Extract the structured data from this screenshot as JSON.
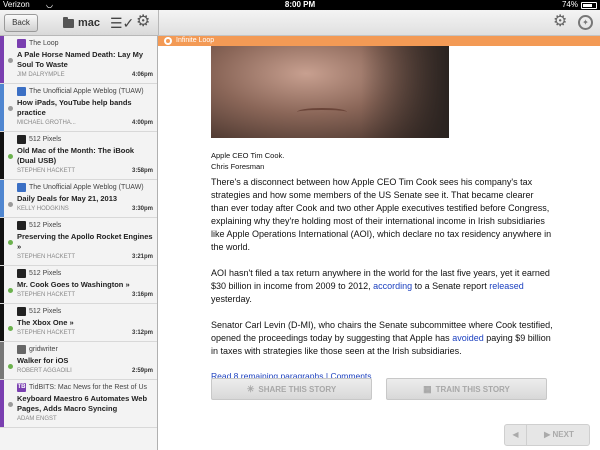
{
  "status_bar": {
    "carrier": "Verizon",
    "time": "8:00 PM",
    "battery": "74%",
    "battery_level": 0.74
  },
  "left_toolbar": {
    "back_label": "Back",
    "folder_label": "mac"
  },
  "stories": [
    {
      "feed": "The Loop",
      "feed_color": "#7a3fb0",
      "title": "A Pale Horse Named Death: Lay My Soul To Waste",
      "author": "JIM DALRYMPLE",
      "time": "4:06pm",
      "stripe_color": "#7a3fb0",
      "dot": "gray"
    },
    {
      "feed": "The Unofficial Apple Weblog (TUAW)",
      "feed_color": "#3b6fc4",
      "title": "How iPads, YouTube help bands practice",
      "author": "MICHAEL GROTHA...",
      "time": "4:00pm",
      "stripe_color": "#4f86d0",
      "dot": "gray"
    },
    {
      "feed": "512 Pixels",
      "feed_color": "#222222",
      "title": "Old Mac of the Month: The iBook (Dual USB)",
      "author": "STEPHEN HACKETT",
      "time": "3:58pm",
      "stripe_color": "#111111",
      "dot": "green"
    },
    {
      "feed": "The Unofficial Apple Weblog (TUAW)",
      "feed_color": "#3b6fc4",
      "title": "Daily Deals for May 21, 2013",
      "author": "KELLY HODGKINS",
      "time": "3:30pm",
      "stripe_color": "#4f86d0",
      "dot": "gray"
    },
    {
      "feed": "512 Pixels",
      "feed_color": "#222222",
      "title": "Preserving the Apollo Rocket Engines »",
      "author": "STEPHEN HACKETT",
      "time": "3:21pm",
      "stripe_color": "#111111",
      "dot": "green"
    },
    {
      "feed": "512 Pixels",
      "feed_color": "#222222",
      "title": "Mr. Cook Goes to Washington »",
      "author": "STEPHEN HACKETT",
      "time": "3:16pm",
      "stripe_color": "#111111",
      "dot": "green"
    },
    {
      "feed": "512 Pixels",
      "feed_color": "#222222",
      "title": "The Xbox One »",
      "author": "STEPHEN HACKETT",
      "time": "3:12pm",
      "stripe_color": "#111111",
      "dot": "green"
    },
    {
      "feed": "gridwriter",
      "feed_color": "#666666",
      "title": "Walker for iOS",
      "author": "ROBERT AGGAOILI",
      "time": "2:59pm",
      "stripe_color": "#777777",
      "dot": "green"
    },
    {
      "feed": "TidBITS: Mac News for the Rest of Us",
      "feed_color": "#7a3fb0",
      "feed_glyph": "TB",
      "title": "Keyboard Maestro 6 Automates Web Pages, Adds Macro Syncing",
      "author": "ADAM ENGST",
      "time": "",
      "stripe_color": "#7a3fb0",
      "dot": "gray"
    }
  ],
  "article": {
    "feed_name": "Infinite Loop",
    "caption_1": "Apple CEO Tim Cook.",
    "caption_2": "Chris Foresman",
    "para_1": "There's a disconnect between how Apple CEO Tim Cook sees his company's tax strategies and how some members of the US Senate see it. That became clearer than ever today after Cook and two other Apple executives testified before Congress, explaining why they're holding most of their international income in Irish subsidiaries like Apple Operations International (AOI), which declare no tax residency anywhere in the world.",
    "para_2_a": "AOI hasn't filed a tax return anywhere in the world for the last five years, yet it earned $30 billion in income from 2009 to 2012, ",
    "para_2_link1": "according",
    "para_2_b": " to a Senate report ",
    "para_2_link2": "released",
    "para_2_c": " yesterday.",
    "para_3_a": "Senator Carl Levin (D-MI), who chairs the Senate subcommittee where Cook testified, opened the proceedings today by suggesting that Apple has ",
    "para_3_link": "avoided",
    "para_3_b": " paying $9 billion in taxes with strategies like those seen at the Irish subsidiaries.",
    "read_more": "Read 8 remaining paragraphs",
    "separator": "|",
    "comments": "Comments"
  },
  "actions": {
    "share_label": "SHARE THIS STORY",
    "train_label": "TRAIN THIS STORY"
  },
  "navigation": {
    "next_label": "NEXT"
  }
}
